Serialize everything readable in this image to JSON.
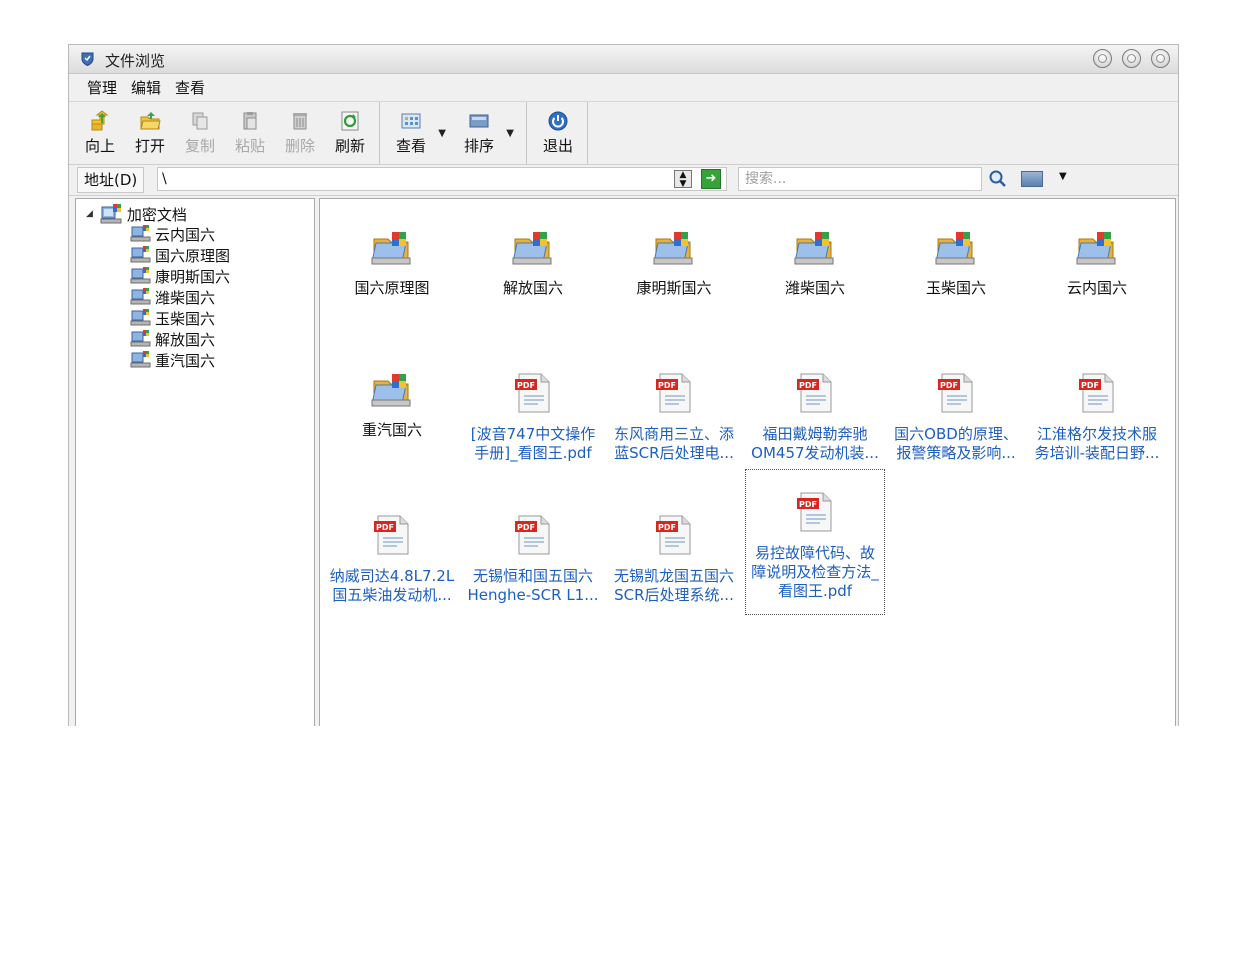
{
  "window": {
    "title": "文件浏览"
  },
  "menu": [
    "管理",
    "编辑",
    "查看"
  ],
  "toolbar": {
    "up": "向上",
    "open": "打开",
    "copy": "复制",
    "paste": "粘贴",
    "delete": "删除",
    "refresh": "刷新",
    "view": "查看",
    "sort": "排序",
    "exit": "退出"
  },
  "address": {
    "label": "地址(D)",
    "value": "\\"
  },
  "search": {
    "placeholder": "搜索..."
  },
  "tree": {
    "root": "加密文档",
    "items": [
      "云内国六",
      "国六原理图",
      "康明斯国六",
      "潍柴国六",
      "玉柴国六",
      "解放国六",
      "重汽国六"
    ]
  },
  "files": [
    {
      "type": "folder",
      "line1": "国六原理图",
      "line2": ""
    },
    {
      "type": "folder",
      "line1": "解放国六",
      "line2": ""
    },
    {
      "type": "folder",
      "line1": "康明斯国六",
      "line2": ""
    },
    {
      "type": "folder",
      "line1": "潍柴国六",
      "line2": ""
    },
    {
      "type": "folder",
      "line1": "玉柴国六",
      "line2": ""
    },
    {
      "type": "folder",
      "line1": "云内国六",
      "line2": ""
    },
    {
      "type": "folder",
      "line1": "重汽国六",
      "line2": ""
    },
    {
      "type": "pdf",
      "line1": "[波音747中文操作",
      "line2": "手册]_看图王.pdf"
    },
    {
      "type": "pdf",
      "line1": "东风商用三立、添",
      "line2": "蓝SCR后处理电..."
    },
    {
      "type": "pdf",
      "line1": "福田戴姆勒奔驰",
      "line2": "OM457发动机装..."
    },
    {
      "type": "pdf",
      "line1": "国六OBD的原理、",
      "line2": "报警策略及影响..."
    },
    {
      "type": "pdf",
      "line1": "江淮格尔发技术服",
      "line2": "务培训-装配日野..."
    },
    {
      "type": "pdf",
      "line1": "纳威司达4.8L7.2L",
      "line2": "国五柴油发动机..."
    },
    {
      "type": "pdf",
      "line1": "无锡恒和国五国六",
      "line2": "Henghe-SCR L1..."
    },
    {
      "type": "pdf",
      "line1": "无锡凯龙国五国六",
      "line2": "SCR后处理系统..."
    },
    {
      "type": "pdf",
      "line1": "易控故障代码、故",
      "line2": "障说明及检查方法_",
      "line3": "看图王.pdf",
      "selected": true
    }
  ],
  "colors": {
    "link": "#1c5fbf",
    "pdf_badge": "#d6281f"
  }
}
